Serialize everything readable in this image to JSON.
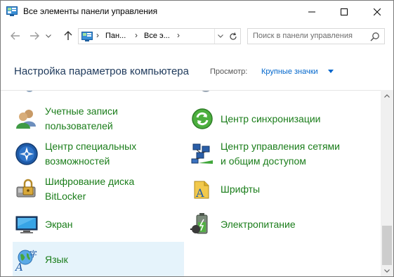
{
  "window": {
    "title": "Все элементы панели управления"
  },
  "address": {
    "crumbs": [
      "Пан...",
      "Все э..."
    ],
    "search_placeholder": "Поиск в панели управления"
  },
  "header": {
    "title": "Настройка параметров компьютера",
    "view_label": "Просмотр:",
    "view_value": "Крупные значки"
  },
  "items": [
    {
      "line1": "Учетные записи",
      "line2": "пользователей",
      "icon": "users-icon"
    },
    {
      "line1": "Центр синхронизации",
      "line2": "",
      "icon": "sync-center-icon"
    },
    {
      "line1": "Центр специальных",
      "line2": "возможностей",
      "icon": "accessibility-icon"
    },
    {
      "line1": "Центр управления сетями",
      "line2": "и общим доступом",
      "icon": "network-icon"
    },
    {
      "line1": "Шифрование диска",
      "line2": "BitLocker",
      "icon": "bitlocker-icon"
    },
    {
      "line1": "Шрифты",
      "line2": "",
      "icon": "fonts-icon"
    },
    {
      "line1": "Экран",
      "line2": "",
      "icon": "display-icon"
    },
    {
      "line1": "Электропитание",
      "line2": "",
      "icon": "power-icon"
    },
    {
      "line1": "Язык",
      "line2": "",
      "icon": "language-icon"
    }
  ],
  "colors": {
    "item_text": "#1a7d1a",
    "header_title": "#1e395b",
    "link": "#0066cc",
    "selected_bg": "#e5f3fb"
  }
}
